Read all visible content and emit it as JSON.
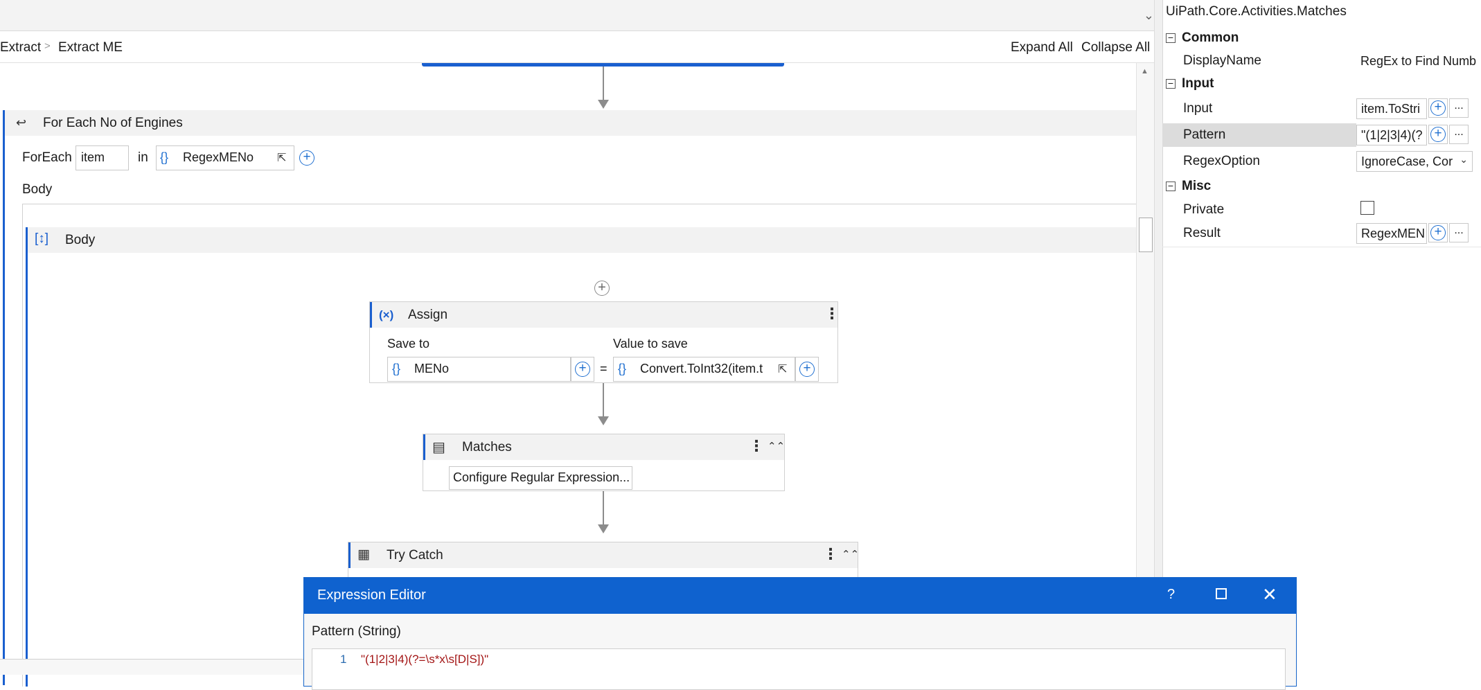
{
  "breadcrumb": {
    "items": [
      "Extract",
      "Extract ME"
    ],
    "separator": ">"
  },
  "toolbar": {
    "expand_all": "Expand All",
    "collapse_all": "Collapse All"
  },
  "foreach": {
    "title": "For Each No of Engines",
    "foreach_label": "ForEach",
    "item_value": "item",
    "in_label": "in",
    "collection_value": "RegexMENo",
    "body_label": "Body"
  },
  "body_sequence": {
    "title": "Body"
  },
  "assign": {
    "title": "Assign",
    "save_to_label": "Save to",
    "value_to_save_label": "Value to save",
    "save_to_value": "MENo",
    "equals": "=",
    "value_to_save": "Convert.ToInt32(item.t"
  },
  "matches": {
    "title": "Matches",
    "configure_button": "Configure Regular Expression..."
  },
  "trycatch": {
    "title": "Try Catch"
  },
  "properties": {
    "header": "UiPath.Core.Activities.Matches",
    "sections": {
      "common": "Common",
      "input": "Input",
      "misc": "Misc"
    },
    "rows": {
      "displayname": {
        "label": "DisplayName",
        "value": "RegEx to Find Numb"
      },
      "input": {
        "label": "Input",
        "value": "item.ToStri"
      },
      "pattern": {
        "label": "Pattern",
        "value": "\"(1|2|3|4)(?"
      },
      "regexoption": {
        "label": "RegexOption",
        "value": "IgnoreCase, Cor"
      },
      "private": {
        "label": "Private",
        "checked": false
      },
      "result": {
        "label": "Result",
        "value": "RegexMEN"
      }
    },
    "ellipsis": "..."
  },
  "expression_editor": {
    "title": "Expression Editor",
    "help": "?",
    "label": "Pattern (String)",
    "line_number": "1",
    "code": "\"(1|2|3|4)(?=\\s*x\\s[D|S])\""
  },
  "colors": {
    "accent": "#0f62cf",
    "code_text": "#a31515",
    "activity_stripe": "#1a5fcf"
  }
}
